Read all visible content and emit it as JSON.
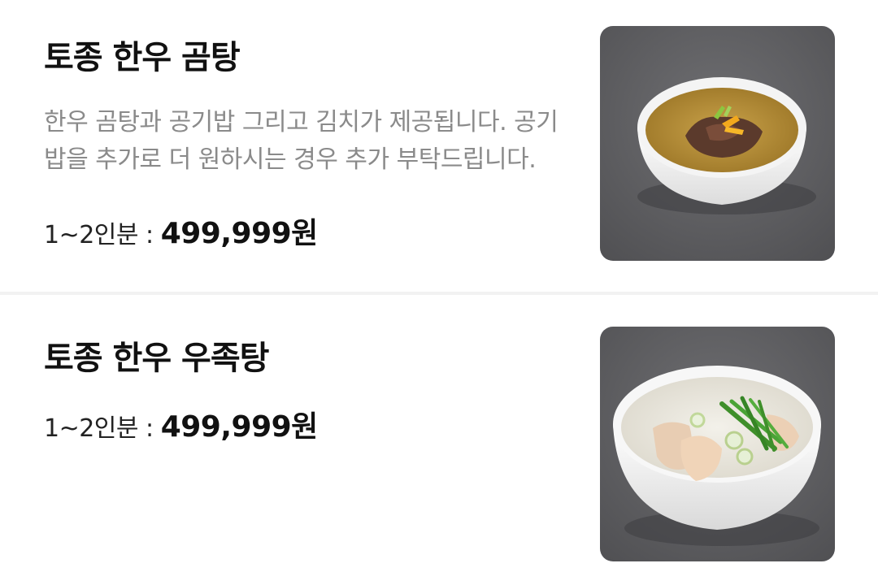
{
  "menu": {
    "items": [
      {
        "title": "토종 한우 곰탕",
        "description": "한우 곰탕과 공기밥 그리고 김치가 제공됩니다. 공기밥을 추가로 더 원하시는 경우 추가 부탁드립니다.",
        "portion": "1~2인분 : ",
        "price": "499,999원",
        "image_icon": "beef-bone-soup-photo"
      },
      {
        "title": "토종 한우 우족탕",
        "portion": "1~2인분 : ",
        "price": "499,999원",
        "image_icon": "ox-feet-soup-photo"
      }
    ]
  },
  "colors": {
    "title": "#111111",
    "description": "#8a8a8a",
    "divider": "#f2f2f2",
    "photo_background": "#5d5d5f"
  }
}
